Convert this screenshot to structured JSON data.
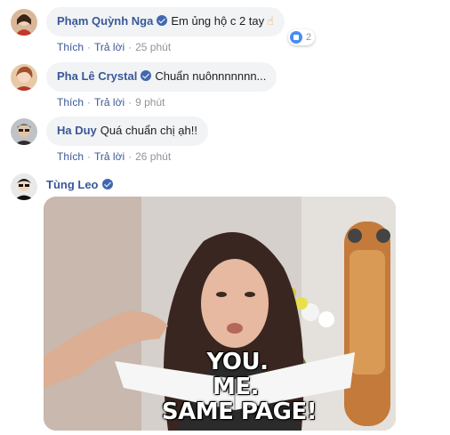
{
  "comments": [
    {
      "author": "Phạm Quỳnh Nga",
      "text": "Em ủng hộ c 2 tay",
      "like_label": "Thích",
      "reply_label": "Trả lời",
      "time": "25 phút",
      "reaction_count": "2"
    },
    {
      "author": "Pha Lê Crystal",
      "text": "Chuẩn nuônnnnnnn...",
      "like_label": "Thích",
      "reply_label": "Trả lời",
      "time": "9 phút"
    },
    {
      "author": "Ha Duy",
      "text": "Quá chuẩn chị ạh!!",
      "like_label": "Thích",
      "reply_label": "Trả lời",
      "time": "26 phút"
    }
  ],
  "post": {
    "author": "Tùng Leo",
    "gif_caption": [
      "YOU.",
      "ME.",
      "SAME PAGE!"
    ]
  },
  "colors": {
    "link": "#385898",
    "bubble": "#f2f3f5",
    "meta": "#90949c",
    "verified": "#4267b2"
  }
}
